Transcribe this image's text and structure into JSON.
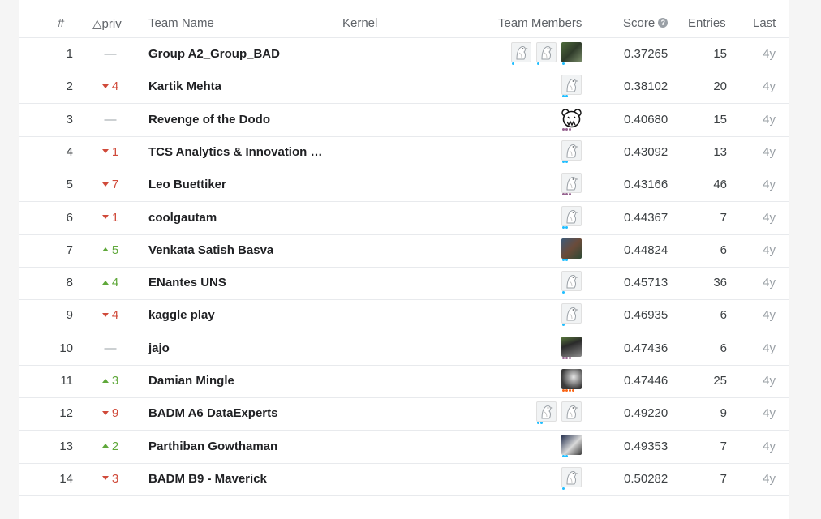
{
  "header": {
    "rank": "#",
    "delta": "△priv",
    "team_name": "Team Name",
    "kernel": "Kernel",
    "team_members": "Team Members",
    "score": "Score",
    "entries": "Entries",
    "last": "Last"
  },
  "colors": {
    "up": "#5fa83a",
    "down": "#d04a3a",
    "tier_cyan": "#20beff",
    "tier_purple": "#95628f",
    "tier_orange": "#f96517"
  },
  "rows": [
    {
      "rank": "1",
      "change": "none",
      "delta": "—",
      "team": "Group A2_Group_BAD",
      "score": "0.37265",
      "entries": "15",
      "last": "4y",
      "members": [
        {
          "icon": "default-avatar-icon",
          "tier": "cyan",
          "dots": 1
        },
        {
          "icon": "default-avatar-icon",
          "tier": "cyan",
          "dots": 1
        },
        {
          "icon": "photo-avatar",
          "style": "photo1",
          "tier": "cyan",
          "dots": 1
        }
      ]
    },
    {
      "rank": "2",
      "change": "down",
      "delta": "4",
      "team": "Kartik Mehta",
      "score": "0.38102",
      "entries": "20",
      "last": "4y",
      "members": [
        {
          "icon": "default-avatar-icon",
          "tier": "cyan",
          "dots": 2
        }
      ]
    },
    {
      "rank": "3",
      "change": "none",
      "delta": "—",
      "team": "Revenge of the Dodo",
      "score": "0.40680",
      "entries": "15",
      "last": "4y",
      "members": [
        {
          "icon": "bear-avatar-icon",
          "tier": "purple",
          "dots": 3
        }
      ]
    },
    {
      "rank": "4",
      "change": "down",
      "delta": "1",
      "team": "TCS Analytics & Innovation L...",
      "score": "0.43092",
      "entries": "13",
      "last": "4y",
      "members": [
        {
          "icon": "default-avatar-icon",
          "tier": "cyan",
          "dots": 2
        }
      ]
    },
    {
      "rank": "5",
      "change": "down",
      "delta": "7",
      "team": "Leo Buettiker",
      "score": "0.43166",
      "entries": "46",
      "last": "4y",
      "members": [
        {
          "icon": "default-avatar-icon",
          "tier": "purple",
          "dots": 3
        }
      ]
    },
    {
      "rank": "6",
      "change": "down",
      "delta": "1",
      "team": "coolgautam",
      "score": "0.44367",
      "entries": "7",
      "last": "4y",
      "members": [
        {
          "icon": "default-avatar-icon",
          "tier": "cyan",
          "dots": 2
        }
      ]
    },
    {
      "rank": "7",
      "change": "up",
      "delta": "5",
      "team": "Venkata Satish Basva",
      "score": "0.44824",
      "entries": "6",
      "last": "4y",
      "members": [
        {
          "icon": "photo-avatar",
          "style": "photo2",
          "tier": "cyan",
          "dots": 2
        }
      ]
    },
    {
      "rank": "8",
      "change": "up",
      "delta": "4",
      "team": "ENantes UNS",
      "score": "0.45713",
      "entries": "36",
      "last": "4y",
      "members": [
        {
          "icon": "default-avatar-icon",
          "tier": "cyan",
          "dots": 1
        }
      ]
    },
    {
      "rank": "9",
      "change": "down",
      "delta": "4",
      "team": "kaggle play",
      "score": "0.46935",
      "entries": "6",
      "last": "4y",
      "members": [
        {
          "icon": "default-avatar-icon",
          "tier": "cyan",
          "dots": 1
        }
      ]
    },
    {
      "rank": "10",
      "change": "none",
      "delta": "—",
      "team": "jajo",
      "score": "0.47436",
      "entries": "6",
      "last": "4y",
      "members": [
        {
          "icon": "photo-avatar",
          "style": "photo3",
          "tier": "purple",
          "dots": 3
        }
      ]
    },
    {
      "rank": "11",
      "change": "up",
      "delta": "3",
      "team": "Damian Mingle",
      "score": "0.47446",
      "entries": "25",
      "last": "4y",
      "members": [
        {
          "icon": "photo-avatar",
          "style": "photo4",
          "tier": "orange",
          "dots": 4
        }
      ]
    },
    {
      "rank": "12",
      "change": "down",
      "delta": "9",
      "team": "BADM A6 DataExperts",
      "score": "0.49220",
      "entries": "9",
      "last": "4y",
      "members": [
        {
          "icon": "default-avatar-icon",
          "tier": "cyan",
          "dots": 2
        },
        {
          "icon": "default-avatar-icon",
          "tier": "cyan",
          "dots": 0
        }
      ]
    },
    {
      "rank": "13",
      "change": "up",
      "delta": "2",
      "team": "Parthiban Gowthaman",
      "score": "0.49353",
      "entries": "7",
      "last": "4y",
      "members": [
        {
          "icon": "photo-avatar",
          "style": "photo5",
          "tier": "cyan",
          "dots": 2
        }
      ]
    },
    {
      "rank": "14",
      "change": "down",
      "delta": "3",
      "team": "BADM B9 - Maverick",
      "score": "0.50282",
      "entries": "7",
      "last": "4y",
      "members": [
        {
          "icon": "default-avatar-icon",
          "tier": "cyan",
          "dots": 1
        }
      ]
    }
  ]
}
